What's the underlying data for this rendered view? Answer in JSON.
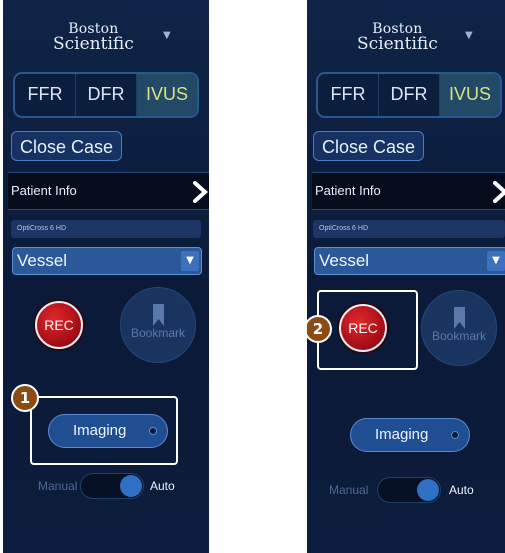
{
  "screens": [
    {
      "logo": {
        "line1": "Boston",
        "line2": "Scientific"
      },
      "modes": [
        "FFR",
        "DFR",
        "IVUS"
      ],
      "active_mode": "IVUS",
      "close_case_label": "Close Case",
      "patient_info_label": "Patient Info",
      "device_label": "OptiCross 6 HD",
      "vessel_value": "Vessel",
      "rec_label": "REC",
      "bookmark_label": "Bookmark",
      "imaging_label": "Imaging",
      "toggle": {
        "left_label": "Manual",
        "right_label": "Auto",
        "state": "Auto"
      },
      "callout_number": "1"
    },
    {
      "logo": {
        "line1": "Boston",
        "line2": "Scientific"
      },
      "modes": [
        "FFR",
        "DFR",
        "IVUS"
      ],
      "active_mode": "IVUS",
      "close_case_label": "Close Case",
      "patient_info_label": "Patient Info",
      "device_label": "OptiCross 6 HD",
      "vessel_value": "Vessel",
      "rec_label": "REC",
      "bookmark_label": "Bookmark",
      "imaging_label": "Imaging",
      "toggle": {
        "left_label": "Manual",
        "right_label": "Auto",
        "state": "Auto"
      },
      "callout_number": "2"
    }
  ],
  "colors": {
    "panel_bg": "#0f2448",
    "active_mode_text": "#d8e27e",
    "rec_red": "#c4161c",
    "callout_badge": "#8a4b14"
  },
  "icons": [
    "chevron-down-icon",
    "chevron-right-icon",
    "bookmark-icon"
  ]
}
